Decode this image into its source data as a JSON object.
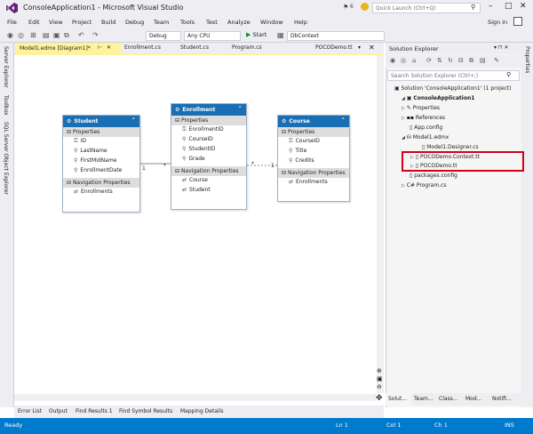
{
  "window": {
    "title": "ConsoleApplication1 - Microsoft Visual Studio",
    "notification_count": "6",
    "quick_launch_placeholder": "Quick Launch (Ctrl+Q)",
    "controls": [
      "–",
      "□",
      "✕"
    ]
  },
  "menu": {
    "items": [
      "File",
      "Edit",
      "View",
      "Project",
      "Build",
      "Debug",
      "Team",
      "Tools",
      "Test",
      "Analyze",
      "Window",
      "Help"
    ],
    "sign_in": "Sign in"
  },
  "toolbar": {
    "config": "Debug",
    "platform": "Any CPU",
    "start_label": "Start",
    "startup_object": "DbContext"
  },
  "left_dock": [
    "Server Explorer",
    "Toolbox",
    "SQL Server Object Explorer"
  ],
  "right_dock": [
    "Properties"
  ],
  "editor_tabs": [
    {
      "label": "Model1.edmx [Diagram1]*",
      "active": true
    },
    {
      "label": "Enrollment.cs"
    },
    {
      "label": "Student.cs"
    },
    {
      "label": "Program.cs"
    },
    {
      "label": "POCODemo.tt"
    }
  ],
  "diagram": {
    "entities": [
      {
        "name": "Student",
        "properties_header": "Properties",
        "properties": [
          "ID",
          "LastName",
          "FirstMidName",
          "EnrollmentDate"
        ],
        "nav_header": "Navigation Properties",
        "navigation": [
          "Enrollments"
        ]
      },
      {
        "name": "Enrollment",
        "properties_header": "Properties",
        "properties": [
          "EnrollmentID",
          "CourseID",
          "StudentID",
          "Grade"
        ],
        "nav_header": "Navigation Properties",
        "navigation": [
          "Course",
          "Student"
        ]
      },
      {
        "name": "Course",
        "properties_header": "Properties",
        "properties": [
          "CourseID",
          "Title",
          "Credits"
        ],
        "nav_header": "Navigation Properties",
        "navigation": [
          "Enrollments"
        ]
      }
    ],
    "associations": [
      {
        "from_mult": "1",
        "to_mult": "*"
      },
      {
        "from_mult": "*",
        "to_mult": "1"
      }
    ]
  },
  "bottom_tabs": [
    "Error List",
    "Output",
    "Find Results 1",
    "Find Symbol Results",
    "Mapping Details"
  ],
  "status": {
    "text": "Ready",
    "line": "Ln 1",
    "col": "Col 1",
    "ch": "Ch 1",
    "mode": "INS"
  },
  "solution_explorer": {
    "title": "Solution Explorer",
    "title_buttons": "▾ ⊓ ✕",
    "search_placeholder": "Search Solution Explorer (Ctrl+;)",
    "tree": [
      {
        "label": "Solution 'ConsoleApplication1' (1 project)",
        "icon": "solution-icon",
        "arrow": ""
      },
      {
        "label": "ConsoleApplication1",
        "icon": "csharp-project-icon",
        "arrow": "◢"
      },
      {
        "label": "Properties",
        "icon": "wrench-icon",
        "arrow": "▷"
      },
      {
        "label": "References",
        "icon": "references-icon",
        "arrow": "▷"
      },
      {
        "label": "App.config",
        "icon": "config-file-icon",
        "arrow": ""
      },
      {
        "label": "Model1.edmx",
        "icon": "edmx-icon",
        "arrow": "◢"
      },
      {
        "label": "Model1.Designer.cs",
        "icon": "cs-file-icon",
        "arrow": ""
      },
      {
        "label": "POCODemo.Context.tt",
        "icon": "tt-file-icon",
        "arrow": "▷"
      },
      {
        "label": "POCODemo.tt",
        "icon": "tt-file-icon",
        "arrow": "▷"
      },
      {
        "label": "packages.config",
        "icon": "config-file-icon",
        "arrow": ""
      },
      {
        "label": "Program.cs",
        "icon": "cs-file-icon",
        "arrow": "▷"
      }
    ],
    "bottom_tabs": [
      "Solut...",
      "Team...",
      "Class...",
      "Mod...",
      "Notifi..."
    ]
  },
  "colors": {
    "chrome": "#eeeef2",
    "entity_header": "#1a6fb4",
    "status_bar": "#007acc",
    "active_tab": "#fff29d",
    "highlight": "#d0021b"
  }
}
